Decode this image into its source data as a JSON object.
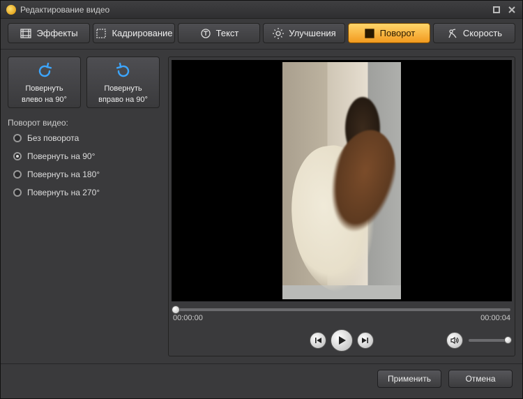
{
  "window": {
    "title": "Редактирование видео"
  },
  "tabs": [
    {
      "label": "Эффекты"
    },
    {
      "label": "Кадрирование"
    },
    {
      "label": "Текст"
    },
    {
      "label": "Улучшения"
    },
    {
      "label": "Поворот"
    },
    {
      "label": "Скорость"
    }
  ],
  "active_tab_index": 4,
  "rotate_buttons": {
    "left": {
      "line1": "Повернуть",
      "line2": "влево  на 90°"
    },
    "right": {
      "line1": "Повернуть",
      "line2": "вправо на 90°"
    }
  },
  "rotation_section": {
    "header": "Поворот видео:"
  },
  "rotation_options": [
    {
      "label": "Без поворота"
    },
    {
      "label": "Повернуть на 90°"
    },
    {
      "label": "Повернуть на 180°"
    },
    {
      "label": "Повернуть на 270°"
    }
  ],
  "selected_rotation_index": 1,
  "player": {
    "current_time": "00:00:00",
    "total_time": "00:00:04"
  },
  "footer": {
    "apply": "Применить",
    "cancel": "Отмена"
  }
}
